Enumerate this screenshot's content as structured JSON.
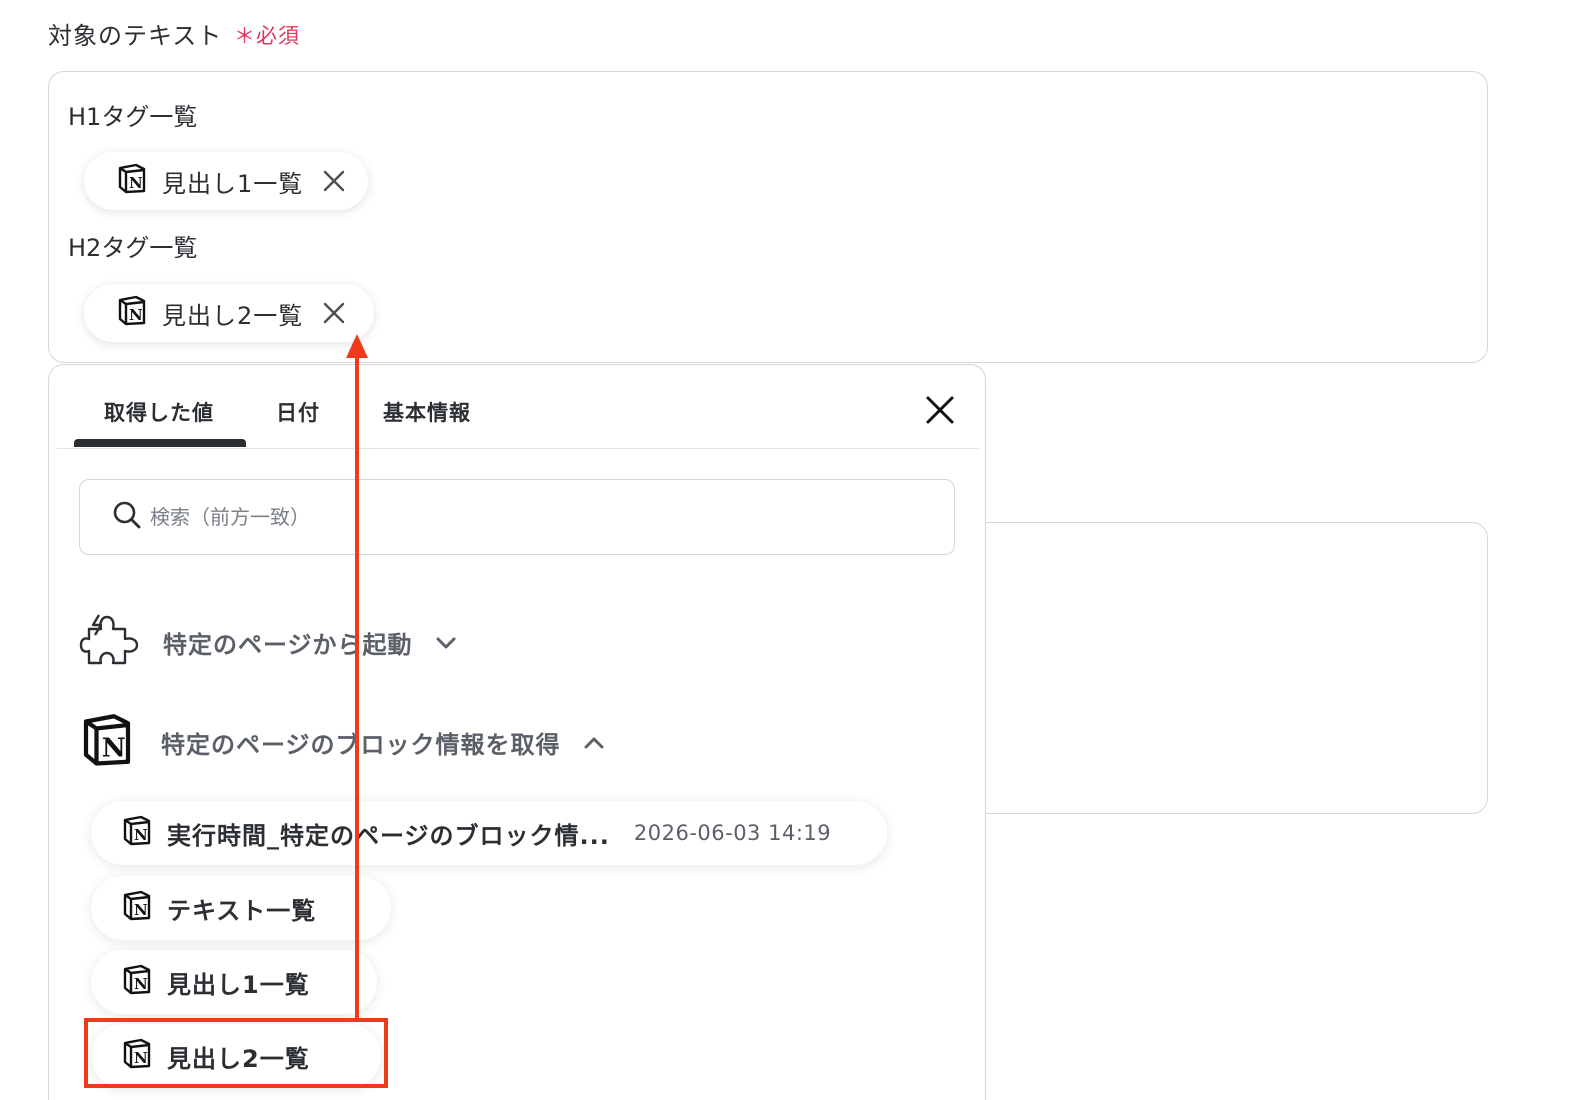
{
  "field": {
    "label": "対象のテキスト",
    "required": "＊必須"
  },
  "text_box": {
    "lines": [
      {
        "label": "H1タグ一覧",
        "chip": "見出し1一覧"
      },
      {
        "label": "H2タグ一覧",
        "chip": "見出し2一覧"
      }
    ]
  },
  "panel": {
    "tabs": [
      "取得した値",
      "日付",
      "基本情報"
    ],
    "active_tab": "取得した値",
    "search_placeholder": "検索（前方一致）",
    "sections": [
      {
        "title": "特定のページから起動",
        "icon": "puzzle-icon",
        "expanded": false
      },
      {
        "title": "特定のページのブロック情報を取得",
        "icon": "notion-icon",
        "expanded": true
      }
    ],
    "items": [
      {
        "label": "実行時間_特定のページのブロック情...",
        "date": "2026-06-03 14:19"
      },
      {
        "label": "テキスト一覧"
      },
      {
        "label": "見出し1一覧"
      },
      {
        "label": "見出し2一覧"
      }
    ]
  },
  "colors": {
    "required": "#e2355c",
    "annotation": "#ef3a1c",
    "text": "#2b2f33"
  }
}
